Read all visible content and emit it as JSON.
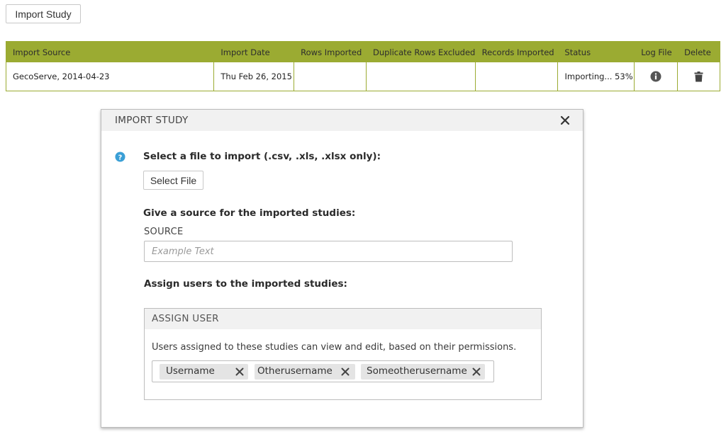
{
  "toolbar": {
    "import_label": "Import Study"
  },
  "table": {
    "headers": [
      "Import Source",
      "Import Date",
      "Rows Imported",
      "Duplicate Rows Excluded",
      "Records Imported",
      "Status",
      "Log File",
      "Delete"
    ],
    "rows": [
      {
        "source": "GecoServe, 2014-04-23",
        "date": "Thu Feb 26, 2015",
        "rows_imported": "",
        "duplicates_excluded": "",
        "records_imported": "",
        "status": "Importing... 53%",
        "log_icon": "info-icon",
        "delete_icon": "trash-icon"
      }
    ]
  },
  "modal": {
    "title": "IMPORT STUDY",
    "select_file_prompt": "Select a file to import (.csv, .xls, .xlsx only):",
    "select_file_button": "Select File",
    "source_prompt": "Give a source for the imported studies:",
    "source_label": "SOURCE",
    "source_placeholder": "Example Text",
    "source_value": "",
    "assign_prompt": "Assign users to the imported studies:",
    "assign_panel": {
      "title": "ASSIGN USER",
      "description": "Users assigned to these studies can view and edit, based on their permissions.",
      "users": [
        "Username",
        "Otherusername",
        "Someotherusername"
      ]
    }
  },
  "colors": {
    "accent_green": "#9bab32",
    "help_blue": "#3a9fd6",
    "tag_bg": "#e4e4e4"
  }
}
